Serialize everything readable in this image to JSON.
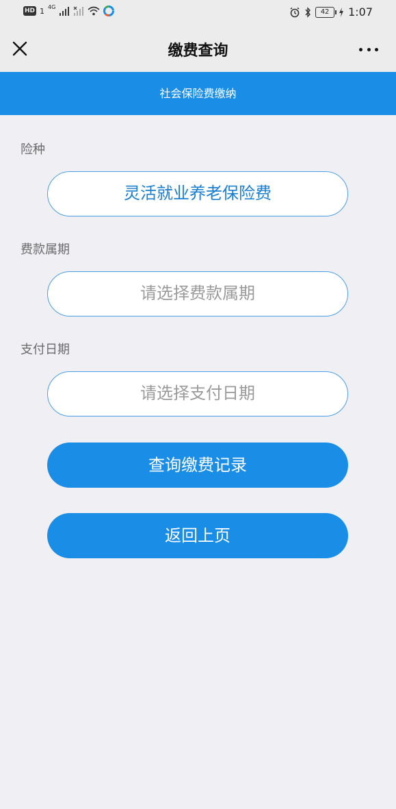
{
  "status_bar": {
    "hd": "HD",
    "sim": "1",
    "network": "4G",
    "battery": "42",
    "time": "1:07"
  },
  "nav": {
    "title": "缴费查询"
  },
  "banner": {
    "text": "社会保险费缴纳"
  },
  "form": {
    "insurance_type_label": "险种",
    "insurance_type_value": "灵活就业养老保险费",
    "period_label": "费款属期",
    "period_placeholder": "请选择费款属期",
    "pay_date_label": "支付日期",
    "pay_date_placeholder": "请选择支付日期"
  },
  "actions": {
    "query_label": "查询缴费记录",
    "back_label": "返回上页"
  },
  "colors": {
    "accent": "#1a8ee6",
    "background": "#efeff4",
    "field_border": "#4a9fe4",
    "value_text": "#1a7fcf",
    "placeholder_text": "#9a9a9a"
  }
}
